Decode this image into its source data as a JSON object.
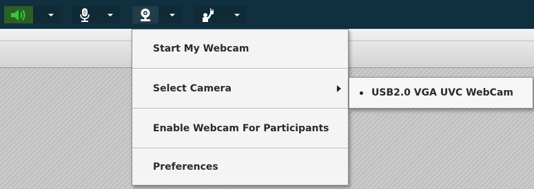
{
  "toolbar": {
    "buttons": [
      {
        "icon": "speaker-icon",
        "caret": "chevron-down-icon",
        "active": true,
        "color": "#33cc33"
      },
      {
        "icon": "microphone-icon",
        "caret": "chevron-down-icon",
        "active": false
      },
      {
        "icon": "webcam-icon",
        "caret": "chevron-down-icon",
        "active": false
      },
      {
        "icon": "raise-hand-icon",
        "caret": "chevron-down-icon",
        "active": false
      }
    ]
  },
  "webcam_menu": {
    "items": [
      {
        "label": "Start My Webcam",
        "has_submenu": false
      },
      {
        "label": "Select Camera",
        "has_submenu": true
      },
      {
        "label": "Enable Webcam For Participants",
        "has_submenu": false
      },
      {
        "label": "Preferences",
        "has_submenu": false
      }
    ]
  },
  "camera_submenu": {
    "items": [
      {
        "label": "USB2.0 VGA UVC WebCam",
        "selected": true
      }
    ]
  },
  "colors": {
    "toolbar_bg": "#11303f",
    "speaker_active": "#33cc33",
    "menu_bg": "#f4f4f4"
  }
}
